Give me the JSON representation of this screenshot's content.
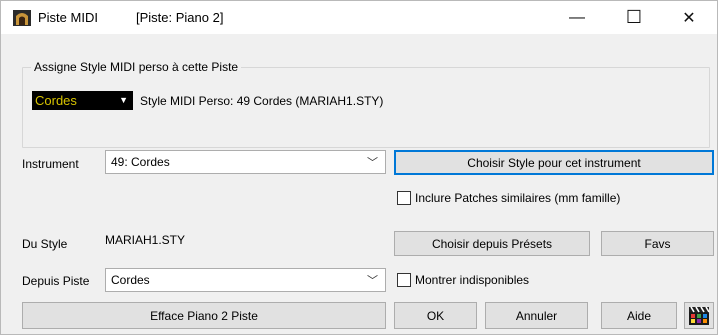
{
  "window": {
    "title": "Piste MIDI",
    "subtitle": "[Piste: Piano 2]",
    "minimize_glyph": "—",
    "maximize_glyph": "☐",
    "close_glyph": "✕"
  },
  "style_group": {
    "label": "Assigne Style MIDI perso à cette Piste",
    "selected_style": "Cordes",
    "info": "Style MIDI Perso: 49 Cordes (MARIAH1.STY)"
  },
  "instrument": {
    "label": "Instrument",
    "value": "49: Cordes",
    "choose_button": "Choisir Style pour cet instrument"
  },
  "include_patches": {
    "label": "Inclure Patches similaires (mm famille)",
    "checked": false
  },
  "du_style": {
    "label": "Du Style",
    "value": "MARIAH1.STY"
  },
  "presets_button": "Choisir depuis Présets",
  "favs_button": "Favs",
  "depuis_piste": {
    "label": "Depuis Piste",
    "value": "Cordes"
  },
  "show_unavailable": {
    "label": "Montrer indisponibles",
    "checked": false
  },
  "footer": {
    "clear_button": "Efface Piano 2 Piste",
    "ok_button": "OK",
    "cancel_button": "Annuler",
    "help_button": "Aide",
    "video_icon": "film-clapper-icon"
  },
  "colors": {
    "accent": "#0078d7",
    "dropdown_bg": "#000000",
    "dropdown_text": "#d7c300"
  }
}
